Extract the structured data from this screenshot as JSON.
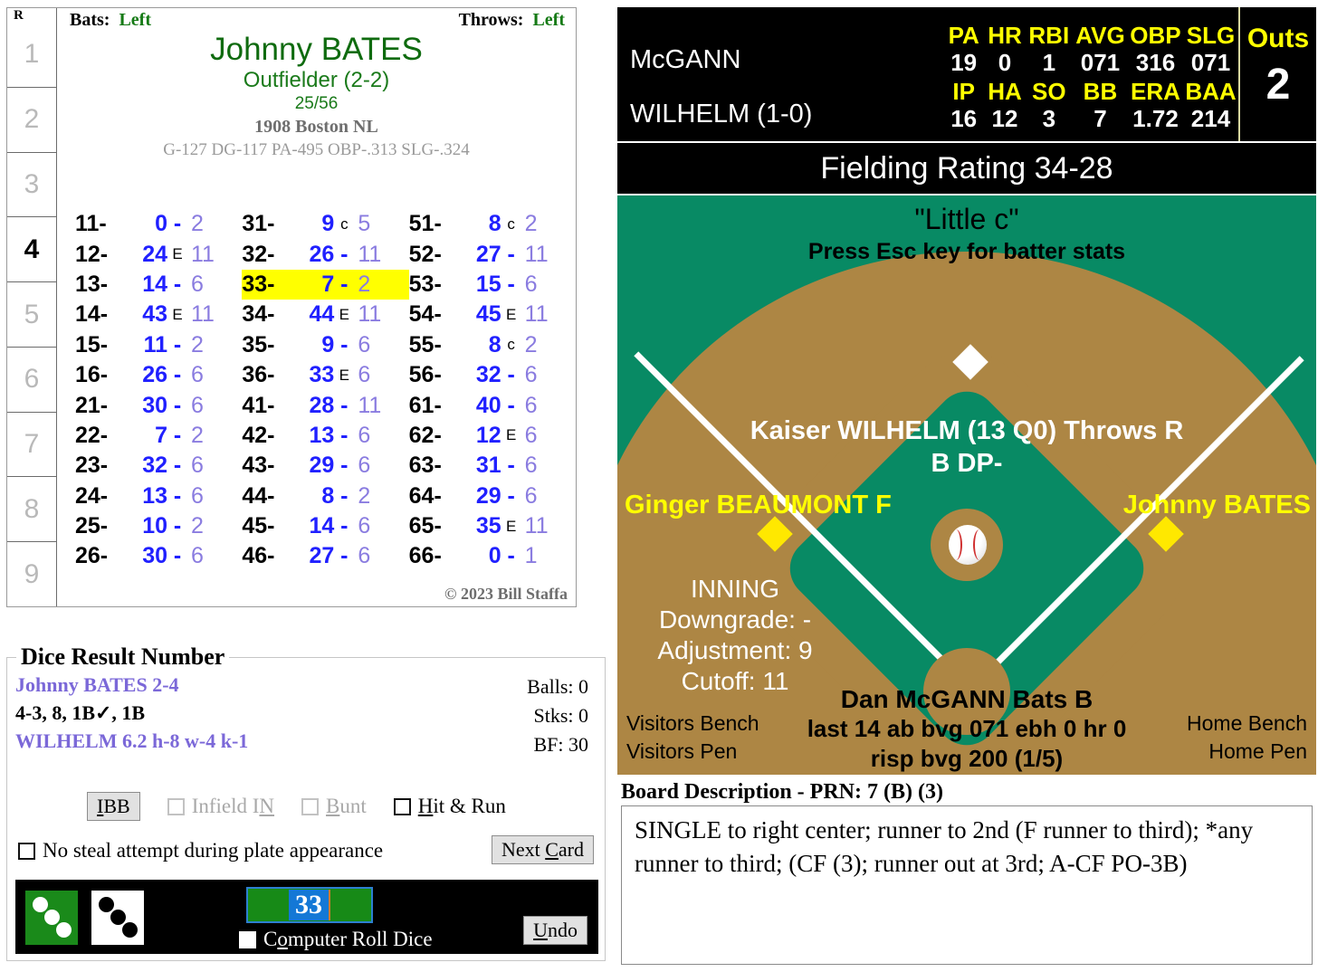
{
  "innings": {
    "header": "R",
    "cells": [
      {
        "label": "1",
        "active": false
      },
      {
        "label": "2",
        "active": false
      },
      {
        "label": "3",
        "active": false
      },
      {
        "label": "4",
        "active": true
      },
      {
        "label": "5",
        "active": false
      },
      {
        "label": "6",
        "active": false
      },
      {
        "label": "7",
        "active": false
      },
      {
        "label": "8",
        "active": false
      },
      {
        "label": "9",
        "active": false
      }
    ]
  },
  "card": {
    "bats_label": "Bats:",
    "bats_value": "Left",
    "throws_label": "Throws:",
    "throws_value": "Left",
    "player_name": "Johnny BATES",
    "position": "Outfielder (2-2)",
    "ratio": "25/56",
    "team": "1908 Boston NL",
    "statline": "G-127 DG-117 PA-495 OBP-.313 SLG-.324",
    "copyright": "© 2023 Bill Staffa",
    "results": [
      [
        {
          "key": "11-",
          "value": "0",
          "marker": "-",
          "suffix": "2",
          "hl": false
        },
        {
          "key": "12-",
          "value": "24",
          "marker": "E",
          "suffix": "11",
          "hl": false
        },
        {
          "key": "13-",
          "value": "14",
          "marker": "-",
          "suffix": "6",
          "hl": false
        },
        {
          "key": "14-",
          "value": "43",
          "marker": "E",
          "suffix": "11",
          "hl": false
        },
        {
          "key": "15-",
          "value": "11",
          "marker": "-",
          "suffix": "2",
          "hl": false
        },
        {
          "key": "16-",
          "value": "26",
          "marker": "-",
          "suffix": "6",
          "hl": false
        },
        {
          "key": "21-",
          "value": "30",
          "marker": "-",
          "suffix": "6",
          "hl": false
        },
        {
          "key": "22-",
          "value": "7",
          "marker": "-",
          "suffix": "2",
          "hl": false
        },
        {
          "key": "23-",
          "value": "32",
          "marker": "-",
          "suffix": "6",
          "hl": false
        },
        {
          "key": "24-",
          "value": "13",
          "marker": "-",
          "suffix": "6",
          "hl": false
        },
        {
          "key": "25-",
          "value": "10",
          "marker": "-",
          "suffix": "2",
          "hl": false
        },
        {
          "key": "26-",
          "value": "30",
          "marker": "-",
          "suffix": "6",
          "hl": false
        }
      ],
      [
        {
          "key": "31-",
          "value": "9",
          "marker": "c",
          "suffix": "5",
          "hl": false
        },
        {
          "key": "32-",
          "value": "26",
          "marker": "-",
          "suffix": "11",
          "hl": false
        },
        {
          "key": "33-",
          "value": "7",
          "marker": "-",
          "suffix": "2",
          "hl": true
        },
        {
          "key": "34-",
          "value": "44",
          "marker": "E",
          "suffix": "11",
          "hl": false
        },
        {
          "key": "35-",
          "value": "9",
          "marker": "-",
          "suffix": "6",
          "hl": false
        },
        {
          "key": "36-",
          "value": "33",
          "marker": "E",
          "suffix": "6",
          "hl": false
        },
        {
          "key": "41-",
          "value": "28",
          "marker": "-",
          "suffix": "11",
          "hl": false
        },
        {
          "key": "42-",
          "value": "13",
          "marker": "-",
          "suffix": "6",
          "hl": false
        },
        {
          "key": "43-",
          "value": "29",
          "marker": "-",
          "suffix": "6",
          "hl": false
        },
        {
          "key": "44-",
          "value": "8",
          "marker": "-",
          "suffix": "2",
          "hl": false
        },
        {
          "key": "45-",
          "value": "14",
          "marker": "-",
          "suffix": "6",
          "hl": false
        },
        {
          "key": "46-",
          "value": "27",
          "marker": "-",
          "suffix": "6",
          "hl": false
        }
      ],
      [
        {
          "key": "51-",
          "value": "8",
          "marker": "c",
          "suffix": "2",
          "hl": false
        },
        {
          "key": "52-",
          "value": "27",
          "marker": "-",
          "suffix": "11",
          "hl": false
        },
        {
          "key": "53-",
          "value": "15",
          "marker": "-",
          "suffix": "6",
          "hl": false
        },
        {
          "key": "54-",
          "value": "45",
          "marker": "E",
          "suffix": "11",
          "hl": false
        },
        {
          "key": "55-",
          "value": "8",
          "marker": "c",
          "suffix": "2",
          "hl": false
        },
        {
          "key": "56-",
          "value": "32",
          "marker": "-",
          "suffix": "6",
          "hl": false
        },
        {
          "key": "61-",
          "value": "40",
          "marker": "-",
          "suffix": "6",
          "hl": false
        },
        {
          "key": "62-",
          "value": "12",
          "marker": "E",
          "suffix": "6",
          "hl": false
        },
        {
          "key": "63-",
          "value": "31",
          "marker": "-",
          "suffix": "6",
          "hl": false
        },
        {
          "key": "64-",
          "value": "29",
          "marker": "-",
          "suffix": "6",
          "hl": false
        },
        {
          "key": "65-",
          "value": "35",
          "marker": "E",
          "suffix": "11",
          "hl": false
        },
        {
          "key": "66-",
          "value": "0",
          "marker": "-",
          "suffix": "1",
          "hl": false
        }
      ]
    ]
  },
  "dice_panel": {
    "title": "Dice Result Number",
    "line1": "Johnny BATES  2-4",
    "line2": "4-3, 8, 1B✓, 1B",
    "line3": "WILHELM  6.2  h-8  w-4  k-1",
    "balls": "Balls: 0",
    "strikes": "Stks: 0",
    "bf": "BF: 30",
    "ibb_label": "IBB",
    "infield_in_label": "Infield IN",
    "bunt_label": "Bunt",
    "hit_run_label": "Hit & Run",
    "no_steal_label": "No steal attempt during plate appearance",
    "next_card_label": "Next Card",
    "roll_value": "33",
    "computer_roll_label": "Computer Roll Dice",
    "undo_label": "Undo",
    "die_green_value": "3",
    "die_white_value": "3"
  },
  "scorebar": {
    "batter_name": "McGANN",
    "pitcher_name": "WILHELM (1-0)",
    "batter_headers": [
      "PA",
      "HR",
      "RBI",
      "AVG",
      "OBP",
      "SLG"
    ],
    "batter_values": [
      "19",
      "0",
      "1",
      "071",
      "316",
      "071"
    ],
    "pitcher_headers": [
      "IP",
      "HA",
      "SO",
      "BB",
      "ERA",
      "BAA"
    ],
    "pitcher_values": [
      "16",
      "12",
      "3",
      "7",
      "1.72",
      "214"
    ],
    "outs_label": "Outs",
    "outs_value": "2"
  },
  "fielding_rating": "Fielding Rating 34-28",
  "field": {
    "little_c": "\"Little c\"",
    "esc_hint": "Press Esc key for batter stats",
    "pitcher": "Kaiser WILHELM (13 Q0) Throws R",
    "bdp": "B DP-",
    "left_fielder": "Ginger BEAUMONT F",
    "right_fielder": "Johnny BATES",
    "inning_label": "INNING",
    "downgrade": "Downgrade: -",
    "adjustment": "Adjustment: 9",
    "cutoff": "Cutoff: 11",
    "batter_line1": "Dan McGANN Bats B",
    "batter_line2": "last 14 ab bvg 071 ebh 0 hr 0",
    "batter_line3": "risp bvg 200 (1/5)",
    "visitors_bench": "Visitors Bench",
    "visitors_pen": "Visitors Pen",
    "home_bench": "Home Bench",
    "home_pen": "Home Pen"
  },
  "board": {
    "title": "Board Description - PRN: 7 (B) (3)",
    "text": "SINGLE to right center; runner to 2nd (F runner to third); *any runner to third; (CF (3); runner out at 3rd; A-CF PO-3B)"
  },
  "colors": {
    "field_green": "#088a64",
    "dirt_tan": "#ad8644",
    "highlight": "#ffff00",
    "accent_blue": "#2020ff"
  }
}
